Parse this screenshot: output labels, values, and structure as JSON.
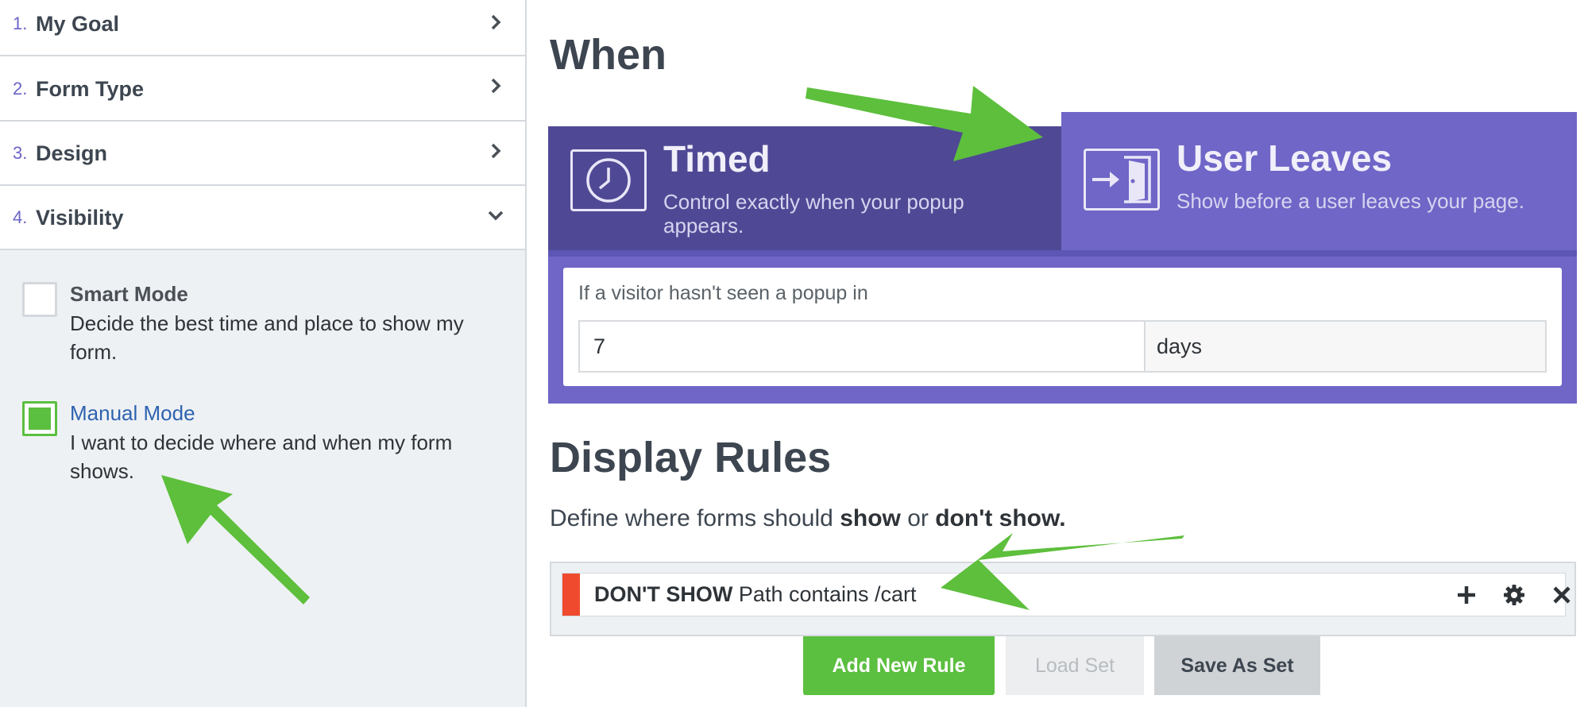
{
  "sidebar": {
    "steps": [
      {
        "num": "1.",
        "label": "My Goal"
      },
      {
        "num": "2.",
        "label": "Form Type"
      },
      {
        "num": "3.",
        "label": "Design"
      },
      {
        "num": "4.",
        "label": "Visibility"
      }
    ],
    "modes": [
      {
        "title": "Smart Mode",
        "desc": "Decide the best time and place to show my form.",
        "checked": false
      },
      {
        "title": "Manual Mode",
        "desc": "I want to decide where and when my form shows.",
        "checked": true
      }
    ]
  },
  "when": {
    "heading": "When",
    "tabs": [
      {
        "title": "Timed",
        "desc": "Control exactly when your popup appears.",
        "icon": "clock-icon"
      },
      {
        "title": "User Leaves",
        "desc": "Show before a user leaves your page.",
        "icon": "exit-door-icon"
      }
    ],
    "question": "If a visitor hasn't seen a popup in",
    "value": "7",
    "unit": "days"
  },
  "rules": {
    "heading": "Display Rules",
    "sub_prefix": "Define where forms should",
    "sub_show": "show",
    "sub_or": "or",
    "sub_dont": "don't show.",
    "items": [
      {
        "action": "DON'T SHOW",
        "condition": "Path contains /cart"
      }
    ],
    "buttons": {
      "add": "Add New Rule",
      "load": "Load Set",
      "save": "Save As Set"
    }
  },
  "colors": {
    "accent_purple": "#6f66c7",
    "dark_purple": "#4f4995",
    "green": "#5bbf3f",
    "red": "#f04a2e",
    "manual_mode_title": "#2f63b0"
  }
}
